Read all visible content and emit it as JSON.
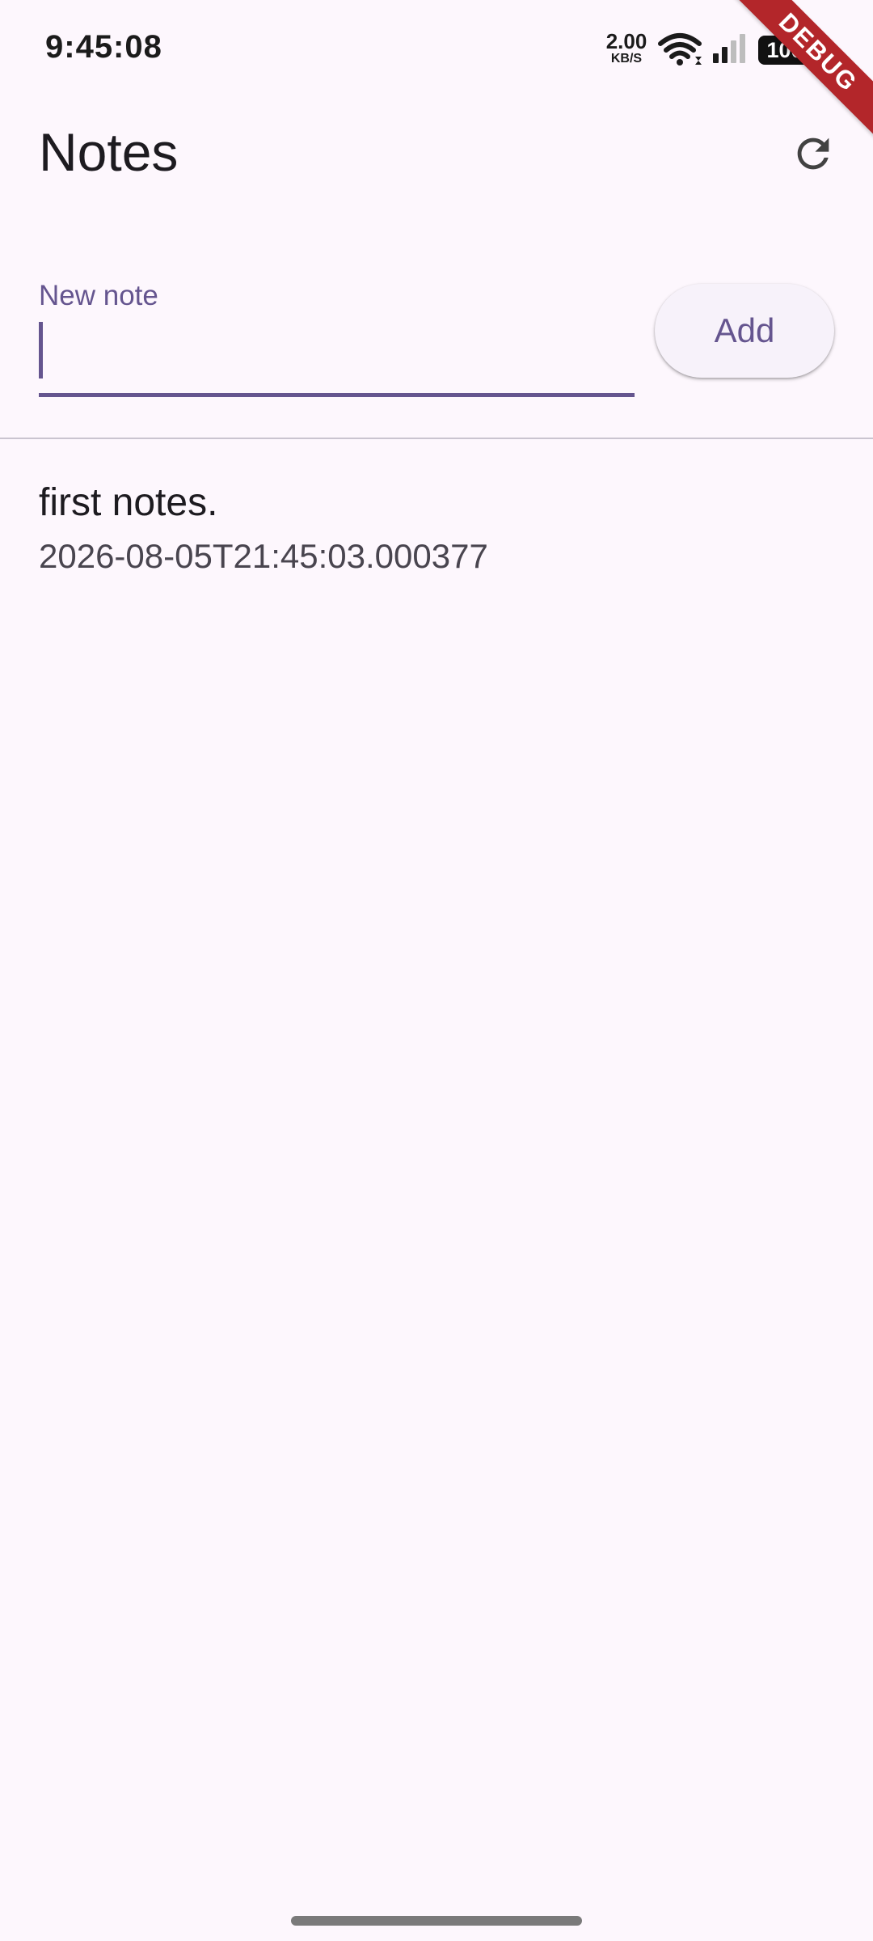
{
  "status_bar": {
    "time": "9:45:08",
    "net_speed_value": "2.00",
    "net_speed_unit": "KB/S",
    "battery": "100",
    "wifi_icon": "wifi-icon",
    "signal_icon": "cellular-signal-icon"
  },
  "debug_banner": "DEBUG",
  "app_bar": {
    "title": "Notes",
    "refresh_icon": "refresh-icon"
  },
  "input": {
    "label": "New note",
    "value": "",
    "add_label": "Add"
  },
  "notes": [
    {
      "title": "first notes.",
      "timestamp": "2026-08-05T21:45:03.000377"
    }
  ],
  "colors": {
    "background": "#FDF7FD",
    "accent": "#65558F",
    "debug": "#B3262A",
    "text": "#1D1B20",
    "secondary_text": "#49454F"
  }
}
